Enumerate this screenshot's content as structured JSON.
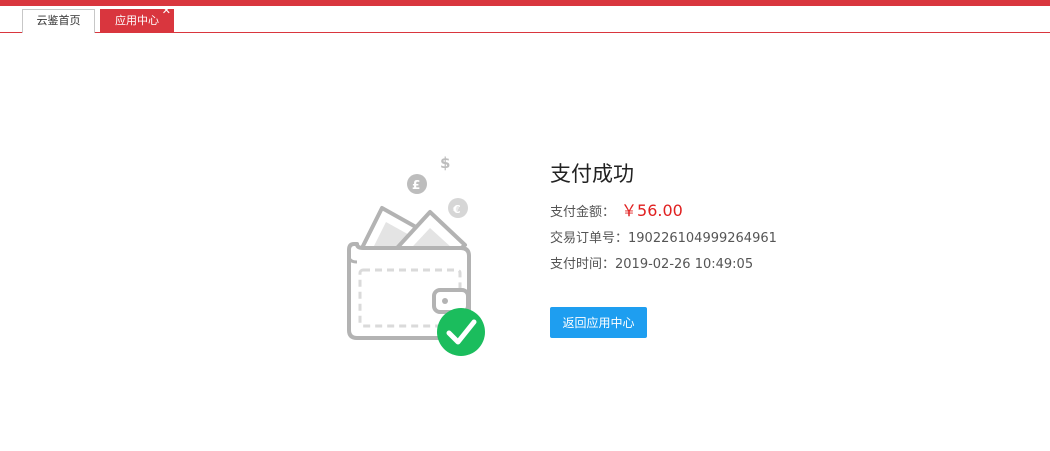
{
  "tabs": [
    {
      "label": "云鉴首页"
    },
    {
      "label": "应用中心",
      "close_glyph": "✕"
    }
  ],
  "illustration": {
    "coin_pound": "£",
    "coin_euro": "€",
    "coin_dollar": "$",
    "check_color": "#1bbd5d"
  },
  "result": {
    "title": "支付成功",
    "amount_label": "支付金额：",
    "amount_value": "￥56.00",
    "order_label": "交易订单号：",
    "order_value": "190226104999264961",
    "time_label": "支付时间：",
    "time_value": "2019-02-26 10:49:05",
    "return_button": "返回应用中心"
  },
  "colors": {
    "brand_red": "#d9363e",
    "amount_red": "#e02020",
    "button_blue": "#1e9ef0"
  }
}
